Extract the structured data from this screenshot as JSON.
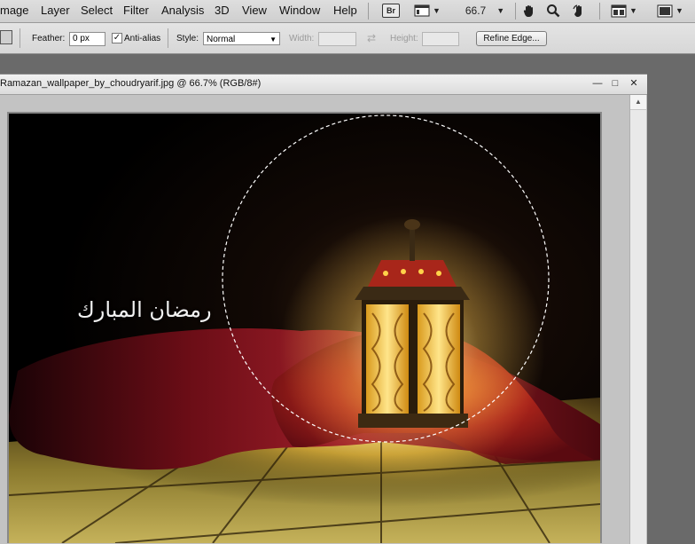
{
  "menu": {
    "items": [
      "mage",
      "Layer",
      "Select",
      "Filter",
      "Analysis",
      "3D",
      "View",
      "Window",
      "Help"
    ],
    "bridge_label": "Br",
    "zoom_value": "66.7"
  },
  "options": {
    "feather_label": "Feather:",
    "feather_value": "0 px",
    "antialias_label": "Anti-alias",
    "antialias_checked": true,
    "style_label": "Style:",
    "style_value": "Normal",
    "width_label": "Width:",
    "height_label": "Height:",
    "refine_label": "Refine Edge..."
  },
  "document": {
    "title": "Ramazan_wallpaper_by_choudryarif.jpg @ 66.7% (RGB/8#)",
    "minimize": "—",
    "maximize": "□",
    "close": "✕"
  },
  "artwork": {
    "caption": "رمضان المبارك"
  },
  "icons": {
    "menu_bar": [
      "bridge-icon",
      "screen-mode-icon",
      "hand-icon",
      "zoom-icon",
      "rotate-view-icon",
      "arrange-documents-icon",
      "screen-mode-full-icon"
    ],
    "options_bar": [
      "ellipse-marquee-tool-icon",
      "swap-icon"
    ]
  },
  "colors": {
    "cloth": "#8e1420",
    "lantern_glow": "#f5c24a",
    "background": "#000000"
  }
}
